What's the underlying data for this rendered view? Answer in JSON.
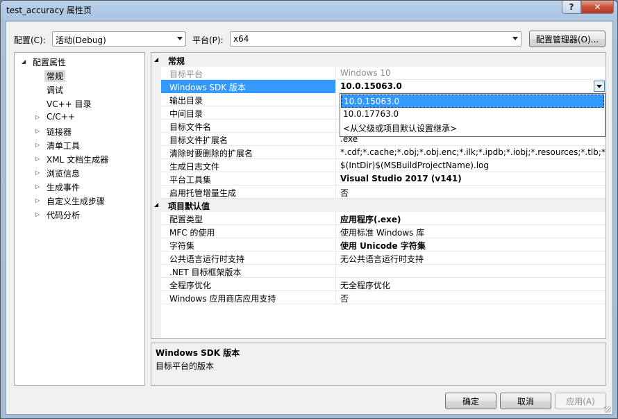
{
  "window": {
    "title": "test_accuracy 属性页",
    "help_glyph": "?",
    "close_glyph": "✕"
  },
  "toolbar": {
    "config_label": "配置(C):",
    "config_value": "活动(Debug)",
    "platform_label": "平台(P):",
    "platform_value": "x64",
    "config_manager_label": "配置管理器(O)..."
  },
  "tree": {
    "items": [
      {
        "label": "配置属性",
        "expander": "◢",
        "level": 0
      },
      {
        "label": "常规",
        "expander": "",
        "level": 1,
        "selected": true
      },
      {
        "label": "调试",
        "expander": "",
        "level": 1
      },
      {
        "label": "VC++ 目录",
        "expander": "",
        "level": 1
      },
      {
        "label": "C/C++",
        "expander": "▷",
        "level": 1
      },
      {
        "label": "链接器",
        "expander": "▷",
        "level": 1
      },
      {
        "label": "清单工具",
        "expander": "▷",
        "level": 1
      },
      {
        "label": "XML 文档生成器",
        "expander": "▷",
        "level": 1
      },
      {
        "label": "浏览信息",
        "expander": "▷",
        "level": 1
      },
      {
        "label": "生成事件",
        "expander": "▷",
        "level": 1
      },
      {
        "label": "自定义生成步骤",
        "expander": "▷",
        "level": 1
      },
      {
        "label": "代码分析",
        "expander": "▷",
        "level": 1
      }
    ]
  },
  "grid": {
    "sections": [
      {
        "title": "常规",
        "expander": "◢",
        "rows": [
          {
            "name": "目标平台",
            "value": "Windows 10",
            "disabled": true
          },
          {
            "name": "Windows SDK 版本",
            "value": "10.0.15063.0",
            "bold": true,
            "selected": true,
            "dropdown": true
          },
          {
            "name": "输出目录",
            "value": ""
          },
          {
            "name": "中间目录",
            "value": ""
          },
          {
            "name": "目标文件名",
            "value": ""
          },
          {
            "name": "目标文件扩展名",
            "value": ".exe"
          },
          {
            "name": "清除时要删除的扩展名",
            "value": "*.cdf;*.cache;*.obj;*.obj.enc;*.ilk;*.ipdb;*.iobj;*.resources;*.tlb;*.tli;*.t"
          },
          {
            "name": "生成日志文件",
            "value": "$(IntDir)$(MSBuildProjectName).log"
          },
          {
            "name": "平台工具集",
            "value": "Visual Studio 2017 (v141)",
            "bold": true
          },
          {
            "name": "启用托管增量生成",
            "value": "否"
          }
        ]
      },
      {
        "title": "项目默认值",
        "expander": "◢",
        "rows": [
          {
            "name": "配置类型",
            "value": "应用程序(.exe)",
            "bold": true
          },
          {
            "name": "MFC 的使用",
            "value": "使用标准 Windows 库"
          },
          {
            "name": "字符集",
            "value": "使用 Unicode 字符集",
            "bold": true
          },
          {
            "name": "公共语言运行时支持",
            "value": "无公共语言运行时支持"
          },
          {
            "name": ".NET 目标框架版本",
            "value": ""
          },
          {
            "name": "全程序优化",
            "value": "无全程序优化"
          },
          {
            "name": "Windows 应用商店应用支持",
            "value": "否"
          }
        ]
      }
    ]
  },
  "dropdown": {
    "options": [
      {
        "label": "10.0.15063.0",
        "highlight": true
      },
      {
        "label": "10.0.17763.0"
      },
      {
        "label": "<从父级或项目默认设置继承>"
      }
    ]
  },
  "description": {
    "title": "Windows SDK 版本",
    "text": "目标平台的版本"
  },
  "buttons": {
    "ok": "确定",
    "cancel": "取消",
    "apply": "应用(A)"
  },
  "colors": {
    "selection": "#3399ff",
    "close_button": "#c7513a"
  },
  "icons": [
    "help-icon",
    "close-icon",
    "chevron-down-icon",
    "tree-expander-icon",
    "resize-grip-icon"
  ]
}
